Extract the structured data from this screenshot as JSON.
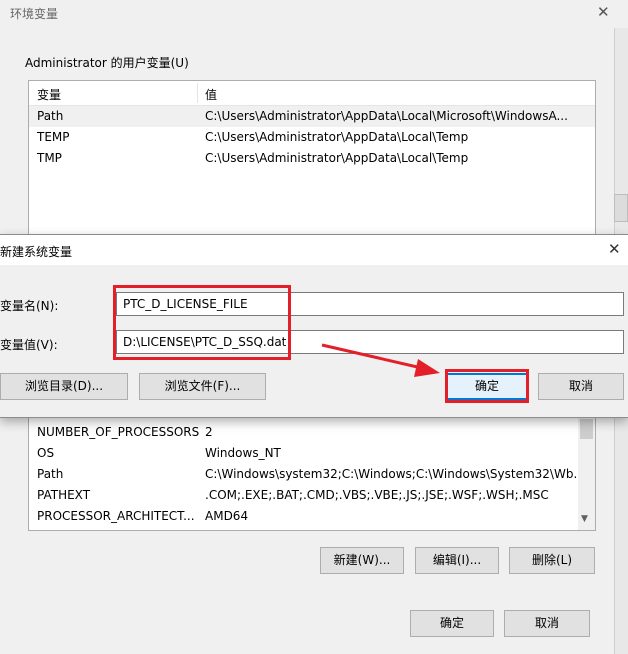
{
  "bg_dialog": {
    "title": "环境变量",
    "close_glyph": "✕",
    "user_section_label": "Administrator 的用户变量(U)",
    "user_table": {
      "headers": [
        "变量",
        "值"
      ],
      "rows": [
        {
          "name": "Path",
          "value": "C:\\Users\\Administrator\\AppData\\Local\\Microsoft\\WindowsA..."
        },
        {
          "name": "TEMP",
          "value": "C:\\Users\\Administrator\\AppData\\Local\\Temp"
        },
        {
          "name": "TMP",
          "value": "C:\\Users\\Administrator\\AppData\\Local\\Temp"
        }
      ]
    },
    "system_table": {
      "rows": [
        {
          "name": "NUMBER_OF_PROCESSORS",
          "value": "2"
        },
        {
          "name": "OS",
          "value": "Windows_NT"
        },
        {
          "name": "Path",
          "value": "C:\\Windows\\system32;C:\\Windows;C:\\Windows\\System32\\Wb..."
        },
        {
          "name": "PATHEXT",
          "value": ".COM;.EXE;.BAT;.CMD;.VBS;.VBE;.JS;.JSE;.WSF;.WSH;.MSC"
        },
        {
          "name": "PROCESSOR_ARCHITECT...",
          "value": "AMD64"
        }
      ]
    },
    "system_buttons": {
      "new": "新建(W)...",
      "edit": "编辑(I)...",
      "delete": "删除(L)"
    },
    "footer_buttons": {
      "ok": "确定",
      "cancel": "取消"
    }
  },
  "new_var_dialog": {
    "title": "新建系统变量",
    "close_glyph": "✕",
    "name_label": "变量名(N):",
    "name_value": "PTC_D_LICENSE_FILE",
    "value_label": "变量值(V):",
    "value_value": "D:\\LICENSE\\PTC_D_SSQ.dat",
    "buttons": {
      "browse_dir": "浏览目录(D)...",
      "browse_file": "浏览文件(F)...",
      "ok": "确定",
      "cancel": "取消"
    }
  },
  "colors": {
    "annotation_red": "#e3202a",
    "accent": "#0078d7"
  }
}
